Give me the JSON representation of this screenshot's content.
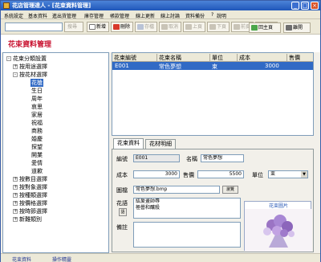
{
  "window": {
    "title": "花店管理達人 - [花束資料管理]",
    "controls": [
      "minimize-icon",
      "maximize-icon",
      "close-icon"
    ]
  },
  "menu": [
    "系統設定",
    "基本資料",
    "進出貨管理",
    "庫存管理",
    "帳款管理",
    "線上更新",
    "線上討論",
    "資料備份",
    "說明"
  ],
  "toolbar": {
    "search_placeholder": "",
    "search_label": "搜尋",
    "buttons": [
      {
        "label": "新增",
        "enabled": true
      },
      {
        "label": "刪除",
        "enabled": true
      },
      {
        "label": "存檔",
        "enabled": false
      },
      {
        "label": "取消",
        "enabled": false
      },
      {
        "label": "上頁",
        "enabled": false
      },
      {
        "label": "下頁",
        "enabled": false
      },
      {
        "label": "前頁",
        "enabled": false
      },
      {
        "label": "後筆",
        "enabled": true
      },
      {
        "label": "回主頁",
        "enabled": true
      },
      {
        "label": "離開",
        "enabled": true
      }
    ]
  },
  "page_title": "花束資料管理",
  "tree": {
    "root": "花束分類設置",
    "groups": [
      {
        "label": "按用途選擇",
        "expanded": false
      },
      {
        "label": "按花材選擇",
        "expanded": true,
        "children": [
          "花槍",
          "生日",
          "周年",
          "哀思",
          "家居",
          "祝福",
          "商務",
          "婚慶",
          "探望",
          "開業",
          "愛情",
          "道歉"
        ]
      },
      {
        "label": "按數目選擇",
        "expanded": false
      },
      {
        "label": "按對象選擇",
        "expanded": false
      },
      {
        "label": "按種類選擇",
        "expanded": false
      },
      {
        "label": "按價格選擇",
        "expanded": false
      },
      {
        "label": "按時節選擇",
        "expanded": false
      },
      {
        "label": "新難類別",
        "expanded": false
      }
    ],
    "selected": "花槍"
  },
  "grid": {
    "columns": [
      "花束編號",
      "花束名稱",
      "單位",
      "成本",
      "售價"
    ],
    "rows": [
      [
        "E001",
        "常色夢想",
        "束",
        "3000",
        ""
      ]
    ]
  },
  "tabs": [
    "花束資料",
    "花材明細"
  ],
  "form": {
    "code_label": "編號",
    "code_value": "E001",
    "name_label": "名稱",
    "name_value": "常色夢想",
    "cost_label": "成本",
    "cost_value": "3000",
    "price_label": "售價",
    "price_value": "5500",
    "unit_label": "單位",
    "unit_value": "束",
    "image_label": "圖檔",
    "image_value": "常色夢想.bmp",
    "browse_label": "瀏覽",
    "desc_label": "花語",
    "desc_btn": "語",
    "desc_value_line1": "紘爰畫師辱",
    "desc_value_line2": "極嚳和釀殺",
    "note_label": "備註",
    "note_value": "",
    "photo_caption": "花束圖片"
  },
  "status": {
    "left": "花束資料",
    "right": "操作精靈"
  }
}
